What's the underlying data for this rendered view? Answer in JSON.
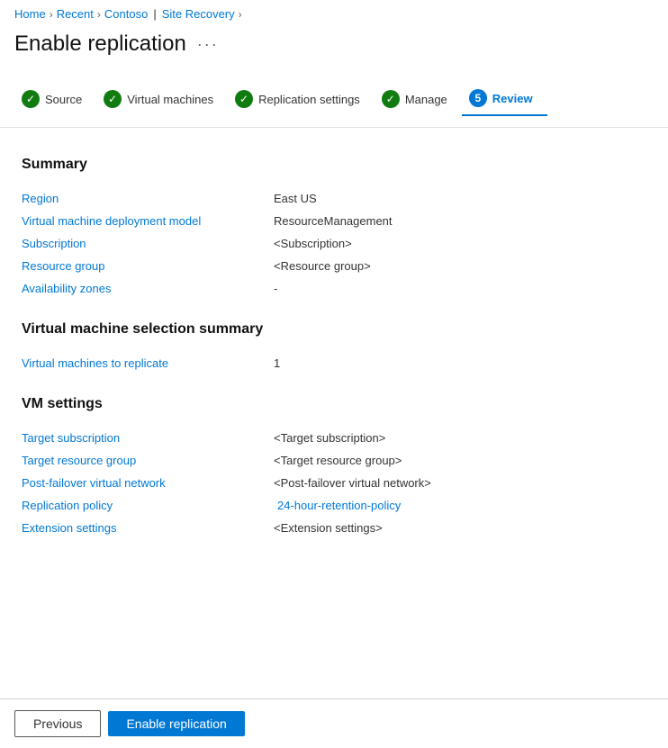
{
  "breadcrumb": {
    "home": "Home",
    "recent": "Recent",
    "contoso": "Contoso",
    "pipe": "|",
    "site_recovery": "Site Recovery"
  },
  "page": {
    "title": "Enable replication",
    "more_icon": "···"
  },
  "steps": [
    {
      "id": "source",
      "label": "Source",
      "type": "check"
    },
    {
      "id": "virtual-machines",
      "label": "Virtual machines",
      "type": "check"
    },
    {
      "id": "replication-settings",
      "label": "Replication settings",
      "type": "check"
    },
    {
      "id": "manage",
      "label": "Manage",
      "type": "check"
    },
    {
      "id": "review",
      "label": "Review",
      "type": "number",
      "number": "5"
    }
  ],
  "summary": {
    "title": "Summary",
    "rows": [
      {
        "label": "Region",
        "value": "East US",
        "type": "text"
      },
      {
        "label": "Virtual machine deployment model",
        "value": "ResourceManagement",
        "type": "text"
      },
      {
        "label": "Subscription",
        "value": "<Subscription>",
        "type": "text"
      },
      {
        "label": "Resource group",
        "value": "<Resource group>",
        "type": "text"
      },
      {
        "label": "Availability zones",
        "value": "-",
        "type": "text"
      }
    ]
  },
  "vm_selection": {
    "title": "Virtual machine selection summary",
    "rows": [
      {
        "label": "Virtual machines to replicate",
        "value": "1",
        "type": "text"
      }
    ]
  },
  "vm_settings": {
    "title": "VM settings",
    "rows": [
      {
        "label": "Target subscription",
        "value": "<Target subscription>",
        "type": "text"
      },
      {
        "label": "Target resource group",
        "value": "<Target resource group>",
        "type": "text"
      },
      {
        "label": "Post-failover virtual network",
        "value": "<Post-failover virtual network>",
        "type": "text"
      },
      {
        "label": "Replication policy",
        "value": "24-hour-retention-policy",
        "type": "link"
      },
      {
        "label": "Extension settings",
        "value": "<Extension settings>",
        "type": "text"
      }
    ]
  },
  "footer": {
    "previous": "Previous",
    "enable_replication": "Enable replication"
  }
}
